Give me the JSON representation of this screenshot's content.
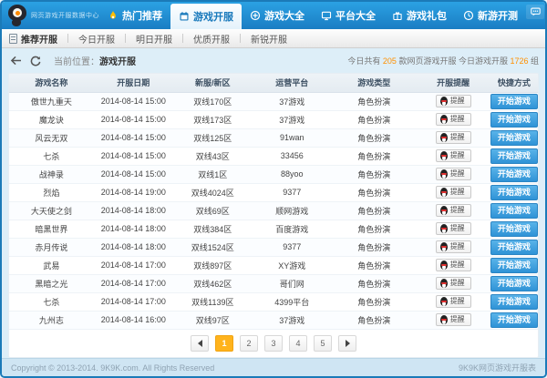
{
  "header": {
    "logo_text": "网页游戏开服数据中心",
    "nav": {
      "items": [
        {
          "label": "热门推荐",
          "icon": "flame-icon",
          "active": false
        },
        {
          "label": "游戏开服",
          "icon": "calendar-icon",
          "active": true
        },
        {
          "label": "游戏大全",
          "icon": "compass-icon",
          "active": false
        },
        {
          "label": "平台大全",
          "icon": "monitor-icon",
          "active": false
        },
        {
          "label": "游戏礼包",
          "icon": "gift-icon",
          "active": false
        },
        {
          "label": "新游开测",
          "icon": "clock-icon",
          "active": false
        }
      ]
    },
    "controls": [
      "feedback",
      "minimize",
      "maximize",
      "close"
    ]
  },
  "subnav": {
    "items": [
      "推荐开服",
      "今日开服",
      "明日开服",
      "优质开服",
      "新锐开服"
    ]
  },
  "breadcrumb": {
    "label": "当前位置：",
    "current": "游戏开服",
    "stats": {
      "part1": "今日共有 ",
      "num1": "205",
      "part2": " 款网页游戏开服 今日游戏开服 ",
      "num2": "1726",
      "part3": " 组"
    }
  },
  "table": {
    "headers": [
      "游戏名称",
      "开服日期",
      "新服/新区",
      "运营平台",
      "游戏类型",
      "开服提醒",
      "快捷方式"
    ],
    "remind_label": "提醒",
    "action_label": "开始游戏",
    "rows": [
      {
        "name": "傲世九重天",
        "date": "2014-08-14 15:00",
        "server": "双线170区",
        "platform": "37游戏",
        "type": "角色扮演"
      },
      {
        "name": "魔龙诀",
        "date": "2014-08-14 15:00",
        "server": "双线173区",
        "platform": "37游戏",
        "type": "角色扮演"
      },
      {
        "name": "风云无双",
        "date": "2014-08-14 15:00",
        "server": "双线125区",
        "platform": "91wan",
        "type": "角色扮演"
      },
      {
        "name": "七杀",
        "date": "2014-08-14 15:00",
        "server": "双线43区",
        "platform": "33456",
        "type": "角色扮演"
      },
      {
        "name": "战神录",
        "date": "2014-08-14 15:00",
        "server": "双线1区",
        "platform": "88yoo",
        "type": "角色扮演"
      },
      {
        "name": "烈焰",
        "date": "2014-08-14 19:00",
        "server": "双线4024区",
        "platform": "9377",
        "type": "角色扮演"
      },
      {
        "name": "大天使之剑",
        "date": "2014-08-14 18:00",
        "server": "双线69区",
        "platform": "顺网游戏",
        "type": "角色扮演"
      },
      {
        "name": "暗黑世界",
        "date": "2014-08-14 18:00",
        "server": "双线384区",
        "platform": "百度游戏",
        "type": "角色扮演"
      },
      {
        "name": "赤月传说",
        "date": "2014-08-14 18:00",
        "server": "双线1524区",
        "platform": "9377",
        "type": "角色扮演"
      },
      {
        "name": "武易",
        "date": "2014-08-14 17:00",
        "server": "双线897区",
        "platform": "XY游戏",
        "type": "角色扮演"
      },
      {
        "name": "黑暗之光",
        "date": "2014-08-14 17:00",
        "server": "双线462区",
        "platform": "哥们网",
        "type": "角色扮演"
      },
      {
        "name": "七杀",
        "date": "2014-08-14 17:00",
        "server": "双线1139区",
        "platform": "4399平台",
        "type": "角色扮演"
      },
      {
        "name": "九州志",
        "date": "2014-08-14 16:00",
        "server": "双线97区",
        "platform": "37游戏",
        "type": "角色扮演"
      }
    ]
  },
  "pagination": {
    "pages": [
      "1",
      "2",
      "3",
      "4",
      "5"
    ],
    "active": "1"
  },
  "footer": {
    "left": "Copyright © 2013-2014. 9K9K.com. All Rights Reserved",
    "right": "9K9K网页游戏开服表"
  },
  "colors": {
    "titlebar_top": "#2ba1e3",
    "titlebar_bottom": "#1a7dc3",
    "window_border": "#1b7ab8",
    "accent_orange": "#ff9000",
    "page_active": "#ffb31c",
    "button_blue": "#3399dd"
  }
}
